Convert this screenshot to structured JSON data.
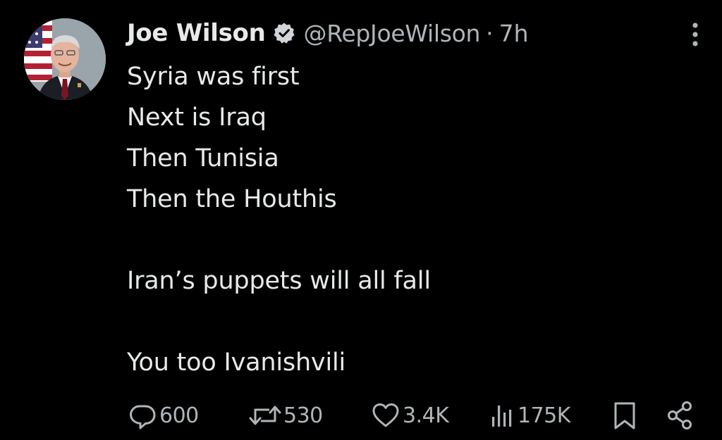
{
  "author": {
    "display_name": "Joe Wilson",
    "handle": "@RepJoeWilson",
    "separator": "·",
    "time": "7h",
    "verified_icon": "verified-badge-icon",
    "colors": {
      "name": "#e7e9ea",
      "handle": "#b0b5b9",
      "badge": "#cfd5d9"
    }
  },
  "tweet": {
    "lines": [
      "Syria was first",
      "Next is Iraq",
      "Then Tunisia",
      "Then the Houthis",
      "",
      "Iran’s puppets will all fall",
      "",
      "You too Ivanishvili"
    ]
  },
  "actions": {
    "reply": {
      "icon": "reply-icon",
      "count": "600"
    },
    "repost": {
      "icon": "repost-icon",
      "count": "530"
    },
    "like": {
      "icon": "heart-icon",
      "count": "3.4K"
    },
    "views": {
      "icon": "views-icon",
      "count": "175K"
    },
    "bookmark": {
      "icon": "bookmark-icon"
    },
    "share": {
      "icon": "share-icon"
    }
  },
  "theme": {
    "background": "#000000",
    "text": "#e7e9ea",
    "muted": "#b0b5b9"
  }
}
